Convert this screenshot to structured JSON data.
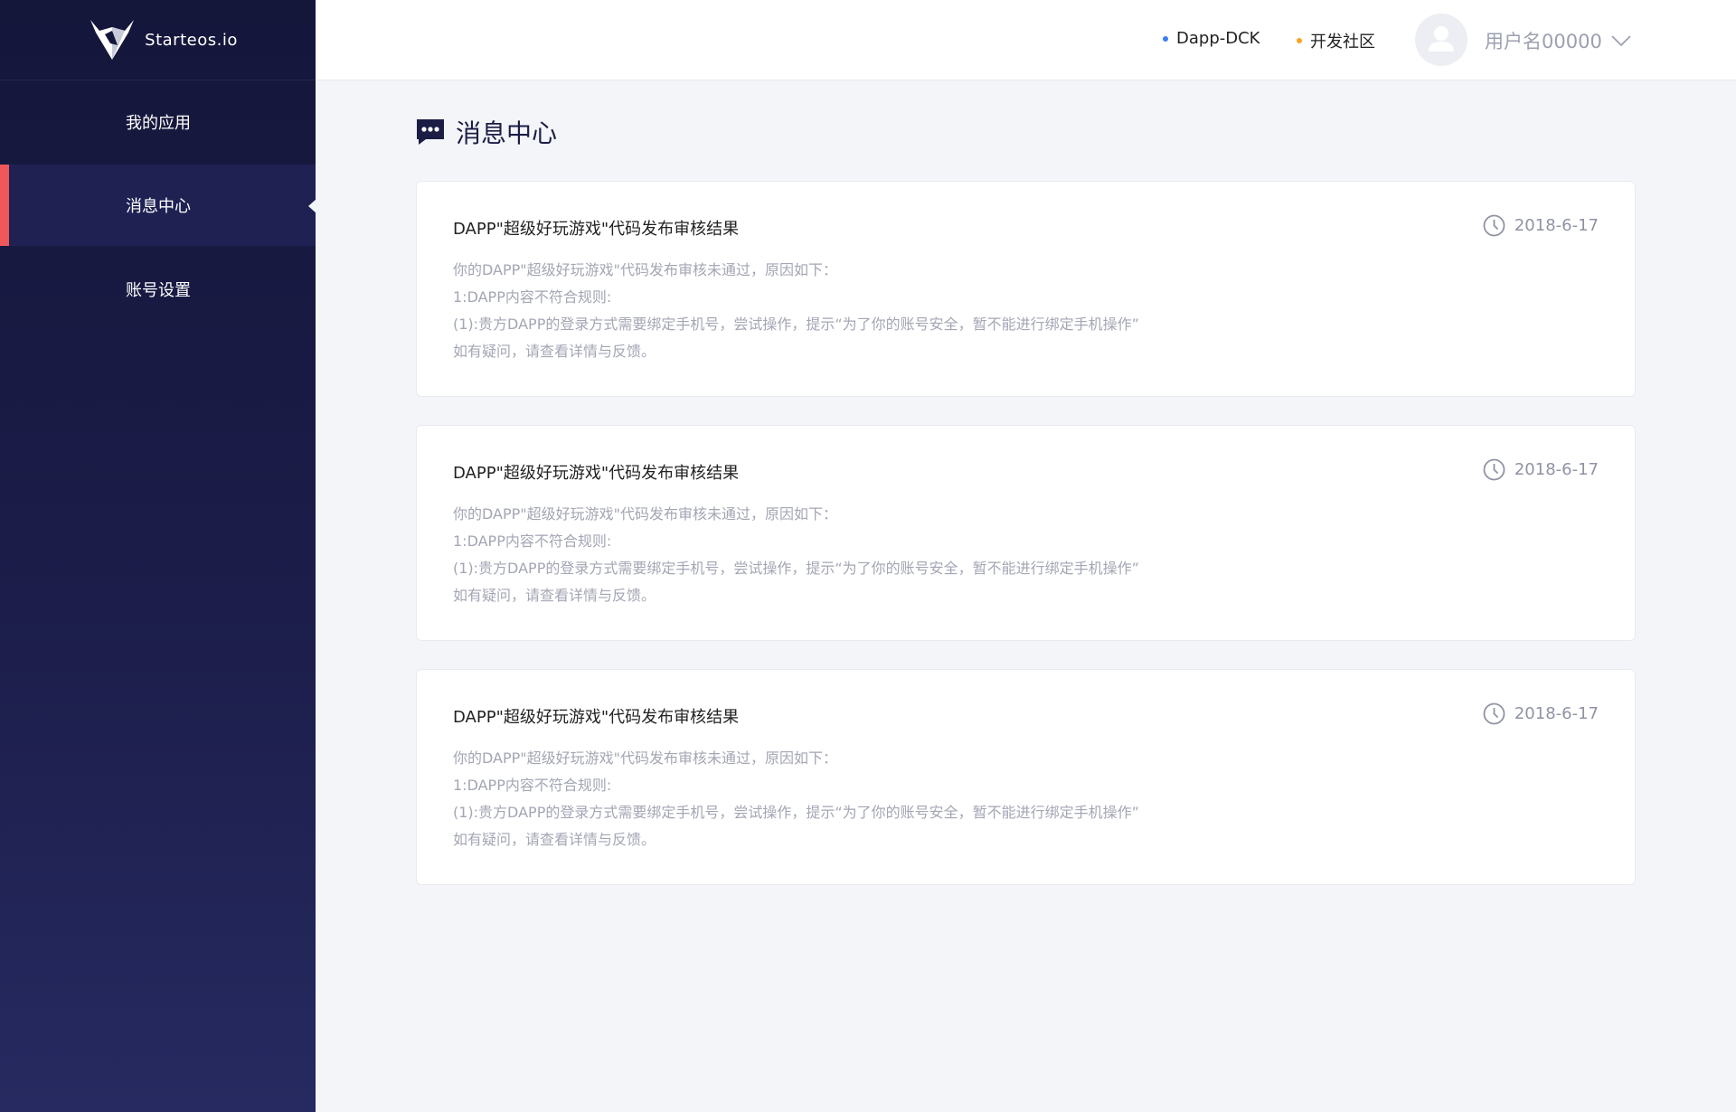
{
  "brand": {
    "name": "Starteos.io"
  },
  "sidebar": {
    "items": [
      {
        "label": "我的应用"
      },
      {
        "label": "消息中心"
      },
      {
        "label": "账号设置"
      }
    ]
  },
  "header": {
    "links": [
      {
        "label": "Dapp-DCK",
        "dot_color": "#3a7df5"
      },
      {
        "label": "开发社区",
        "dot_color": "#f5a623"
      }
    ],
    "username": "用户名00000"
  },
  "page": {
    "title": "消息中心"
  },
  "messages": [
    {
      "title": "DAPP\"超级好玩游戏\"代码发布审核结果",
      "date": "2018-6-17",
      "lines": [
        "你的DAPP\"超级好玩游戏\"代码发布审核未通过，原因如下：",
        "1:DAPP内容不符合规则:",
        "(1):贵方DAPP的登录方式需要绑定手机号，尝试操作，提示“为了你的账号安全，暂不能进行绑定手机操作”",
        "如有疑问，请查看详情与反馈。"
      ]
    },
    {
      "title": "DAPP\"超级好玩游戏\"代码发布审核结果",
      "date": "2018-6-17",
      "lines": [
        "你的DAPP\"超级好玩游戏\"代码发布审核未通过，原因如下：",
        "1:DAPP内容不符合规则:",
        "(1):贵方DAPP的登录方式需要绑定手机号，尝试操作，提示“为了你的账号安全，暂不能进行绑定手机操作”",
        "如有疑问，请查看详情与反馈。"
      ]
    },
    {
      "title": "DAPP\"超级好玩游戏\"代码发布审核结果",
      "date": "2018-6-17",
      "lines": [
        "你的DAPP\"超级好玩游戏\"代码发布审核未通过，原因如下：",
        "1:DAPP内容不符合规则:",
        "(1):贵方DAPP的登录方式需要绑定手机号，尝试操作，提示“为了你的账号安全，暂不能进行绑定手机操作”",
        "如有疑问，请查看详情与反馈。"
      ]
    }
  ]
}
